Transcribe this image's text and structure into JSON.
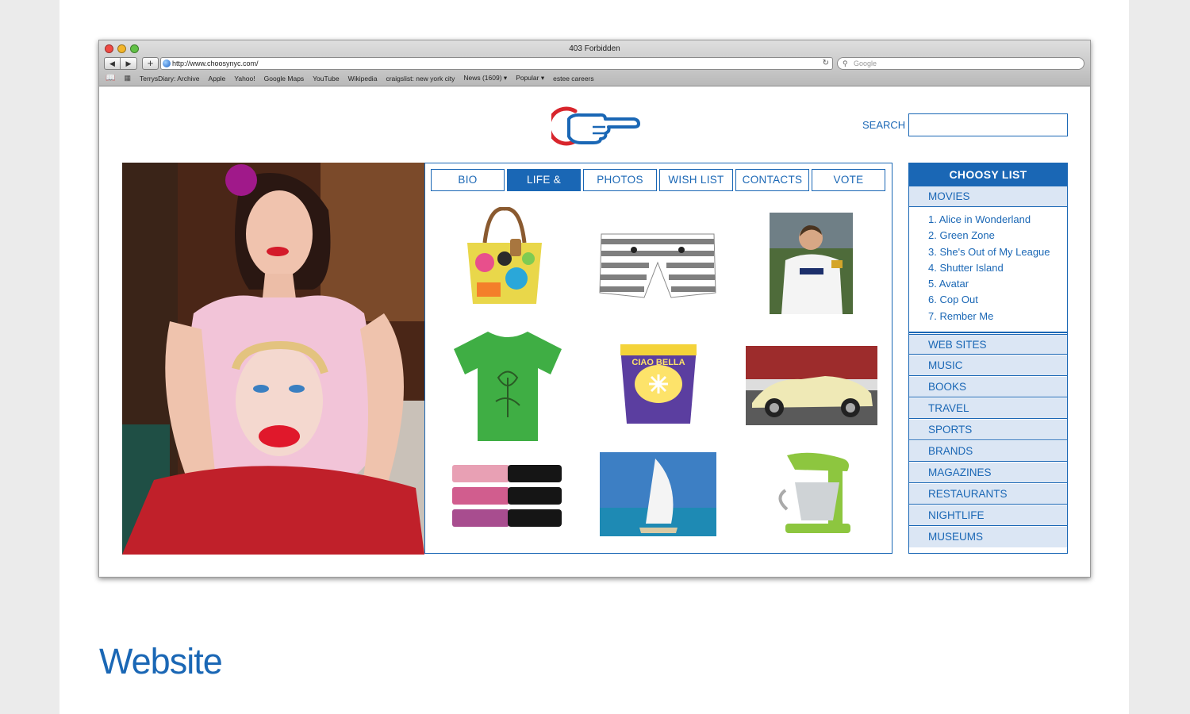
{
  "browser": {
    "window_title": "403 Forbidden",
    "url": "http://www.choosynyc.com/",
    "search_placeholder": "Google",
    "bookmarks": [
      "TerrysDiary: Archive",
      "Apple",
      "Yahoo!",
      "Google Maps",
      "YouTube",
      "Wikipedia",
      "craigslist: new york city",
      "News (1609) ▾",
      "Popular ▾",
      "estee careers"
    ]
  },
  "site": {
    "search_label": "SEARCH",
    "tabs": [
      "BIO",
      "LIFE & STYLE",
      "PHOTOS",
      "WISH LIST",
      "CONTACTS",
      "VOTE"
    ],
    "active_tab": "LIFE & STYLE",
    "choosy_list": {
      "title": "CHOOSY LIST",
      "open_category": "MOVIES",
      "movies": [
        "1. Alice in Wonderland",
        "2. Green Zone",
        "3. She's Out of My League",
        "4. Shutter Island",
        "5. Avatar",
        "6. Cop Out",
        "7. Rember Me"
      ],
      "categories": [
        "WEB SITES",
        "MUSIC",
        "BOOKS",
        "TRAVEL",
        "SPORTS",
        "BRANDS",
        "MAGAZINES",
        "RESTAURANTS",
        "NIGHTLIFE",
        "MUSEUMS"
      ]
    },
    "products": [
      "handbag",
      "striped-shorts",
      "soccer-player-photo",
      "green-tshirt",
      "gelato-pint",
      "vintage-car",
      "lip-gloss-set",
      "burj-al-arab-photo",
      "stand-mixer"
    ],
    "colors": {
      "brand_blue": "#1a67b5",
      "light_blue": "#dbe6f4",
      "logo_red": "#d8252c"
    }
  },
  "caption": "Website"
}
